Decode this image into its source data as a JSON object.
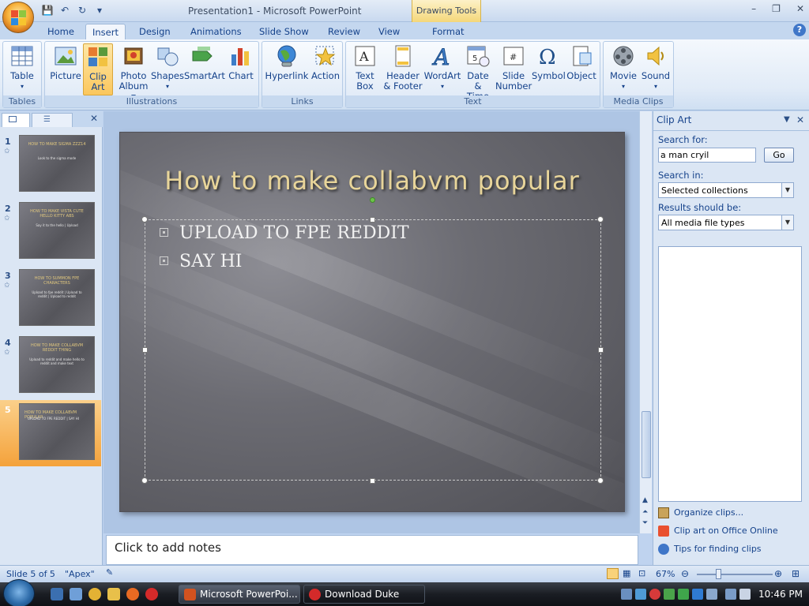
{
  "window": {
    "title": "Presentation1 - Microsoft PowerPoint",
    "context_tab": "Drawing Tools",
    "controls": [
      "–",
      "❐",
      "✕"
    ]
  },
  "tabs": [
    "Home",
    "Insert",
    "Design",
    "Animations",
    "Slide Show",
    "Review",
    "View",
    "Format"
  ],
  "active_tab": "Insert",
  "ribbon": {
    "groups": {
      "tables": "Tables",
      "illustrations": "Illustrations",
      "links": "Links",
      "text": "Text",
      "media": "Media Clips"
    },
    "buttons": {
      "table": "Table",
      "picture": "Picture",
      "clip_art_1": "Clip",
      "clip_art_2": "Art",
      "photo_album_1": "Photo",
      "photo_album_2": "Album",
      "shapes": "Shapes",
      "smartart": "SmartArt",
      "chart": "Chart",
      "hyperlink": "Hyperlink",
      "action": "Action",
      "text_box_1": "Text",
      "text_box_2": "Box",
      "header_footer_1": "Header",
      "header_footer_2": "& Footer",
      "wordart": "WordArt",
      "date_time_1": "Date",
      "date_time_2": "& Time",
      "slide_number_1": "Slide",
      "slide_number_2": "Number",
      "symbol": "Symbol",
      "object": "Object",
      "movie": "Movie",
      "sound": "Sound"
    }
  },
  "slides": [
    {
      "num": "1",
      "title": "How to make sigma zzz14",
      "body": "Look to the sigma mode"
    },
    {
      "num": "2",
      "title": "How to make vista cute hello kitty abs",
      "body": "Say it to the hello | Upload"
    },
    {
      "num": "3",
      "title": "How to summon FPE characters",
      "body": "Upload to fpe reddit | Upload to reddit | Upload to reddit"
    },
    {
      "num": "4",
      "title": "How to make collabvm reddit thing",
      "body": "Upload to reddit and make hello to reddit and make text"
    },
    {
      "num": "5",
      "title": "How to make collabvm popular",
      "body": "UPLOAD TO FPE REDDIT | SAY HI"
    }
  ],
  "current_slide": {
    "title": "How to make collabvm  popular",
    "bullets": [
      "UPLOAD TO FPE REDDIT",
      "SAY HI"
    ]
  },
  "notes_placeholder": "Click to add notes",
  "clip_art": {
    "pane_title": "Clip Art",
    "search_for_label": "Search for:",
    "search_value": "a man cryil",
    "go_label": "Go",
    "search_in_label": "Search in:",
    "search_in_value": "Selected collections",
    "results_label": "Results should be:",
    "results_value": "All media file types",
    "links": [
      "Organize clips...",
      "Clip art on Office Online",
      "Tips for finding clips"
    ]
  },
  "status": {
    "slide_of": "Slide 5 of 5",
    "theme": "\"Apex\"",
    "zoom": "67%",
    "zoom_level": 0.67
  },
  "taskbar": {
    "items": [
      "Microsoft PowerPoi...",
      "Download Duke Nu..."
    ],
    "clock": "10:46 PM"
  },
  "colors": {
    "accent": "#15428b",
    "ribbon_bg": "#dbe6f4",
    "selected_slide": "#f4a23b",
    "title_text": "#e8d59a"
  }
}
